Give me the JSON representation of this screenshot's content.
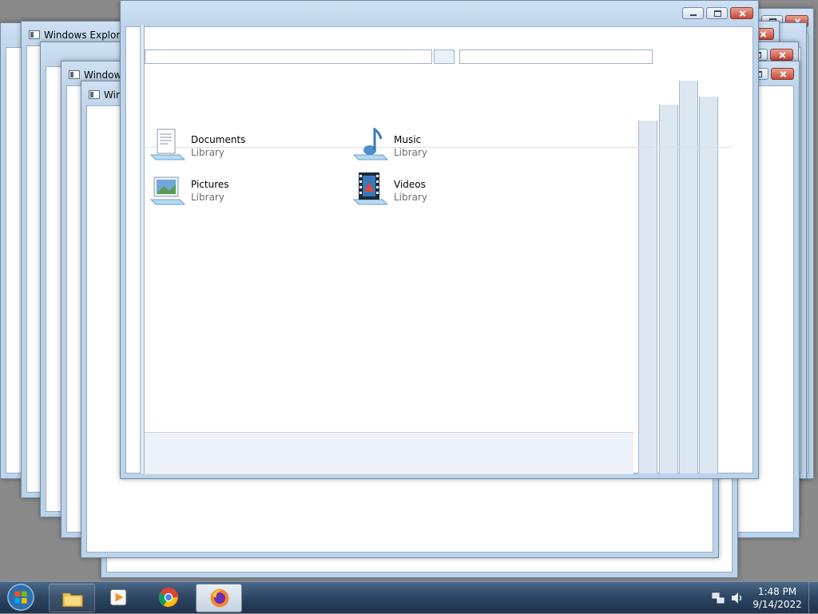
{
  "windows": [
    {
      "title": "Windows Explorer"
    },
    {
      "title": "Windows Explorer"
    },
    {
      "title": "Windows Explorer"
    }
  ],
  "libraries": [
    {
      "name": "Documents",
      "type": "Library",
      "icon": "documents-library-icon"
    },
    {
      "name": "Music",
      "type": "Library",
      "icon": "music-library-icon"
    },
    {
      "name": "Pictures",
      "type": "Library",
      "icon": "pictures-library-icon"
    },
    {
      "name": "Videos",
      "type": "Library",
      "icon": "videos-library-icon"
    }
  ],
  "taskbar": {
    "start": "start-orb-icon",
    "pinned": [
      "windows-explorer-icon",
      "media-player-icon",
      "chrome-icon",
      "firefox-icon"
    ],
    "tray": {
      "network": "network-icon",
      "volume": "speaker-icon"
    },
    "clock": {
      "time": "1:48 PM",
      "date": "9/14/2022"
    }
  },
  "colors": {
    "glass": "#bcd3ea",
    "close_button": "#c8473a",
    "taskbar": "#2e4764"
  }
}
